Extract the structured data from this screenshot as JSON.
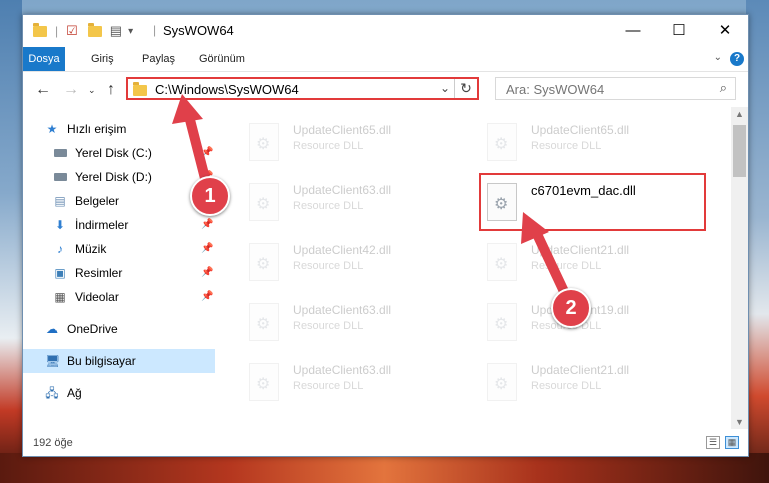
{
  "window": {
    "title": "SysWOW64",
    "controls": {
      "minimize": "—",
      "maximize": "☐",
      "close": "✕"
    }
  },
  "ribbon": {
    "tabs": [
      "Dosya",
      "Giriş",
      "Paylaş",
      "Görünüm"
    ],
    "help": "?"
  },
  "nav": {
    "address": "C:\\Windows\\SysWOW64",
    "search_placeholder": "Ara: SysWOW64"
  },
  "sidebar": {
    "items": [
      {
        "label": "Hızlı erişim",
        "icon": "star-icon",
        "pinned": false
      },
      {
        "label": "Yerel Disk (C:)",
        "icon": "drive-icon",
        "pinned": true
      },
      {
        "label": "Yerel Disk (D:)",
        "icon": "drive-icon",
        "pinned": true
      },
      {
        "label": "Belgeler",
        "icon": "documents-icon",
        "pinned": true
      },
      {
        "label": "İndirmeler",
        "icon": "downloads-icon",
        "pinned": true
      },
      {
        "label": "Müzik",
        "icon": "music-icon",
        "pinned": true
      },
      {
        "label": "Resimler",
        "icon": "pictures-icon",
        "pinned": true
      },
      {
        "label": "Videolar",
        "icon": "videos-icon",
        "pinned": true
      },
      {
        "label": "OneDrive",
        "icon": "cloud-icon",
        "pinned": false
      },
      {
        "label": "Bu bilgisayar",
        "icon": "computer-icon",
        "pinned": false
      },
      {
        "label": "Ağ",
        "icon": "network-icon",
        "pinned": false
      }
    ]
  },
  "files": [
    {
      "name": "UpdateClient65.dll",
      "type": "Resource DLL"
    },
    {
      "name": "UpdateClient65.dll",
      "type": "Resource DLL"
    },
    {
      "name": "UpdateClient63.dll",
      "type": "Resource DLL"
    },
    {
      "name": "c6701evm_dac.dll",
      "type": ""
    },
    {
      "name": "UpdateClient42.dll",
      "type": "Resource DLL"
    },
    {
      "name": "UpdateClient21.dll",
      "type": "Resource DLL"
    },
    {
      "name": "UpdateClient63.dll",
      "type": "Resource DLL"
    },
    {
      "name": "UpdateClient19.dll",
      "type": "Resource DLL"
    },
    {
      "name": "UpdateClient63.dll",
      "type": "Resource DLL"
    },
    {
      "name": "UpdateClient21.dll",
      "type": "Resource DLL"
    }
  ],
  "status": {
    "count": "192 öğe"
  },
  "annotations": {
    "step1": "1",
    "step2": "2",
    "accent": "#e23a3a"
  }
}
